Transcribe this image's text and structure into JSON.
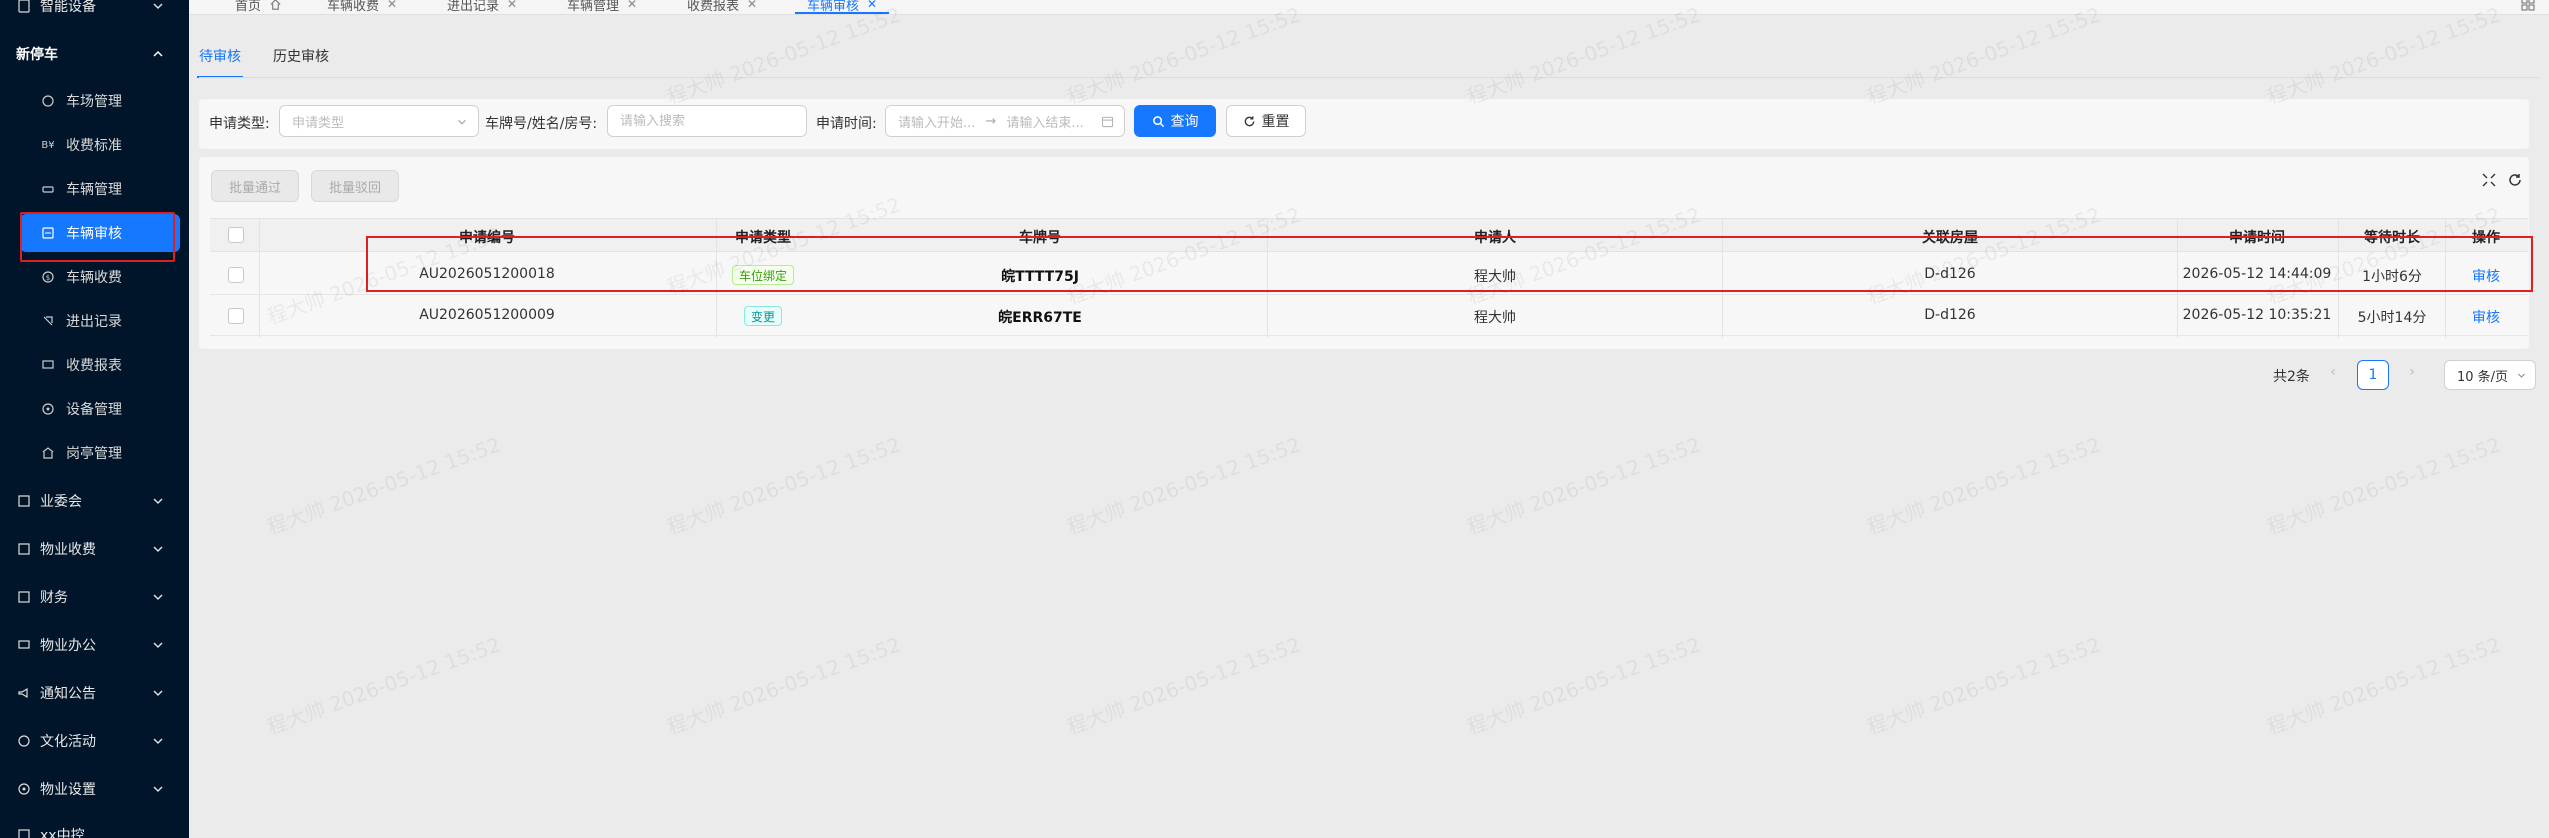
{
  "sidebar": {
    "groups_top": [
      {
        "label": "智能设备",
        "icon": "device-icon"
      }
    ],
    "open_group": {
      "label": "新停车"
    },
    "items": [
      {
        "label": "车场管理",
        "icon": "parking-icon"
      },
      {
        "label": "收费标准",
        "icon": "tag-icon"
      },
      {
        "label": "车辆管理",
        "icon": "car-icon"
      },
      {
        "label": "车辆审核",
        "icon": "audit-icon",
        "active": true
      },
      {
        "label": "车辆收费",
        "icon": "coin-icon"
      },
      {
        "label": "进出记录",
        "icon": "record-icon"
      },
      {
        "label": "收费报表",
        "icon": "report-icon"
      },
      {
        "label": "设备管理",
        "icon": "settings-icon"
      },
      {
        "label": "岗亭管理",
        "icon": "booth-icon"
      }
    ],
    "groups_bottom": [
      {
        "label": "业委会",
        "icon": "committee-icon"
      },
      {
        "label": "物业收费",
        "icon": "fee-icon"
      },
      {
        "label": "财务",
        "icon": "finance-icon"
      },
      {
        "label": "物业办公",
        "icon": "office-icon"
      },
      {
        "label": "通知公告",
        "icon": "notice-icon"
      },
      {
        "label": "文化活动",
        "icon": "culture-icon"
      },
      {
        "label": "物业设置",
        "icon": "property-settings-icon"
      },
      {
        "label": "xx中控",
        "icon": "control-icon"
      }
    ]
  },
  "top_tabs": [
    {
      "label": "首页",
      "home": true
    },
    {
      "label": "车辆收费"
    },
    {
      "label": "进出记录"
    },
    {
      "label": "车辆管理"
    },
    {
      "label": "收费报表"
    },
    {
      "label": "车辆审核",
      "active": true
    }
  ],
  "sub_tabs": {
    "pending": "待审核",
    "history": "历史审核"
  },
  "search": {
    "type_label": "申请类型:",
    "type_placeholder": "申请类型",
    "keyword_label": "车牌号/姓名/房号:",
    "keyword_placeholder": "请输入搜索",
    "time_label": "申请时间:",
    "start_placeholder": "请输入开始...",
    "end_placeholder": "请输入结束...",
    "query_button": "查询",
    "reset_button": "重置"
  },
  "toolbar": {
    "batch_approve": "批量通过",
    "batch_reject": "批量驳回"
  },
  "table": {
    "columns": [
      "申请编号",
      "申请类型",
      "车牌号",
      "申请人",
      "关联房屋",
      "申请时间",
      "等待时长",
      "操作"
    ],
    "rows": [
      {
        "id": "AU2026051200018",
        "type": "车位绑定",
        "plate": "皖TTTT75J",
        "applicant": "程大帅",
        "house": "D-d126",
        "time": "2026-05-12 14:44:09",
        "wait": "1小时6分",
        "action": "审核"
      },
      {
        "id": "AU2026051200009",
        "type": "变更",
        "plate": "皖ERR67TE",
        "applicant": "程大帅",
        "house": "D-d126",
        "time": "2026-05-12 10:35:21",
        "wait": "5小时14分",
        "action": "审核"
      }
    ]
  },
  "pagination": {
    "total": "共2条",
    "page": "1",
    "page_size": "10 条/页"
  },
  "watermark": "程大帅 2026-05-12 15:52",
  "colors": {
    "primary": "#1677ff",
    "sidebar_bg": "#001529",
    "highlight": "#e02020"
  }
}
